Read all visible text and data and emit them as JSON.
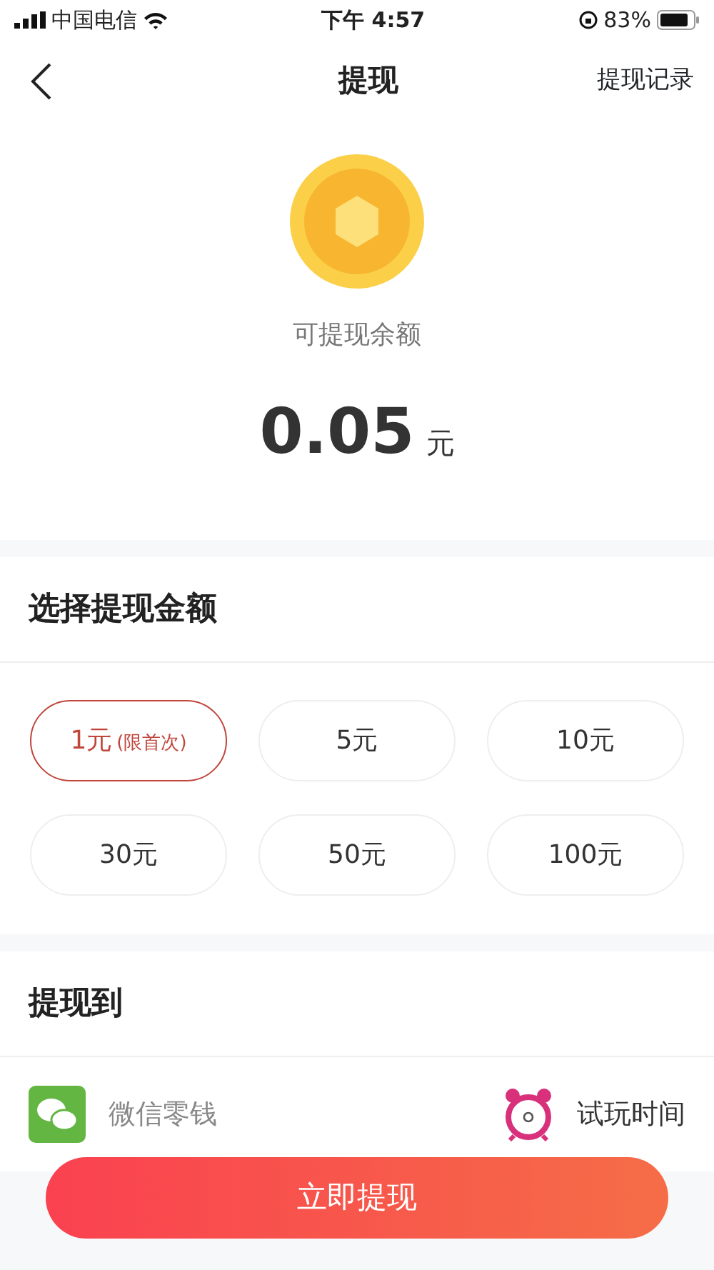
{
  "status_bar": {
    "carrier": "中国电信",
    "time": "下午 4:57",
    "battery": "83%"
  },
  "nav": {
    "title": "提现",
    "action": "提现记录"
  },
  "balance": {
    "label": "可提现余额",
    "amount": "0.05",
    "unit": "元"
  },
  "amount_section": {
    "title": "选择提现金额",
    "options": [
      {
        "amount": "1元",
        "note": "(限首次)",
        "selected": true
      },
      {
        "amount": "5元",
        "selected": false
      },
      {
        "amount": "10元",
        "selected": false
      },
      {
        "amount": "30元",
        "selected": false
      },
      {
        "amount": "50元",
        "selected": false
      },
      {
        "amount": "100元",
        "selected": false
      }
    ]
  },
  "destination_section": {
    "title": "提现到",
    "method": "微信零钱",
    "trial_time": "试玩时间"
  },
  "submit_button": "立即提现"
}
